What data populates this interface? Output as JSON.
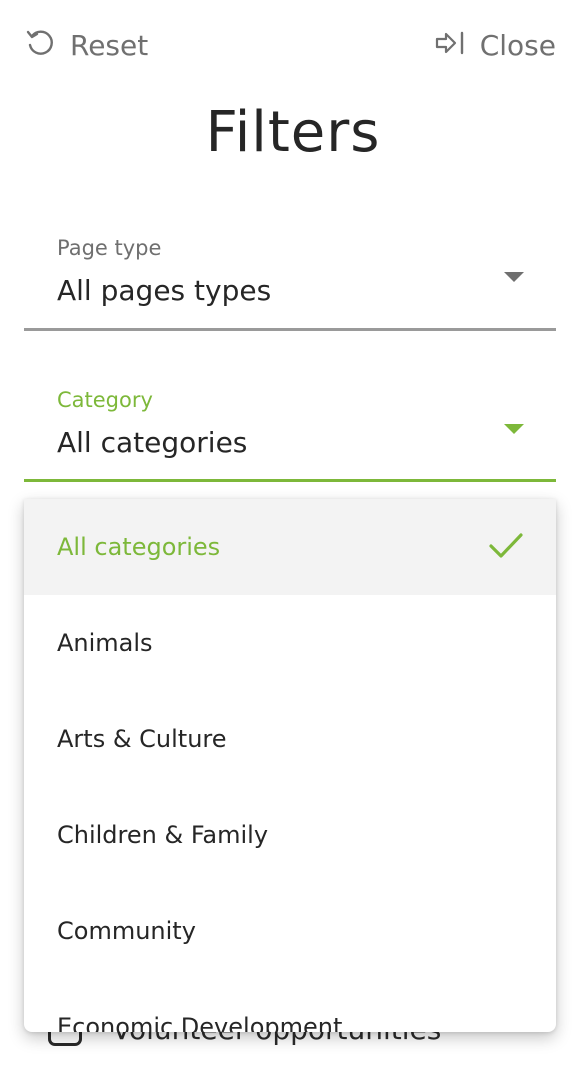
{
  "header": {
    "reset_label": "Reset",
    "close_label": "Close"
  },
  "title": "Filters",
  "filters": {
    "page_type": {
      "label": "Page type",
      "value": "All pages types"
    },
    "category": {
      "label": "Category",
      "value": "All categories"
    }
  },
  "dropdown": {
    "options": [
      {
        "label": "All categories",
        "selected": true
      },
      {
        "label": "Animals"
      },
      {
        "label": "Arts & Culture"
      },
      {
        "label": "Children & Family"
      },
      {
        "label": "Community"
      },
      {
        "label": "Economic Development"
      }
    ]
  },
  "behind": {
    "checkbox_label": "Volunteer opportunities"
  },
  "colors": {
    "accent": "#7db83a",
    "muted": "#707070",
    "text": "#262626"
  }
}
